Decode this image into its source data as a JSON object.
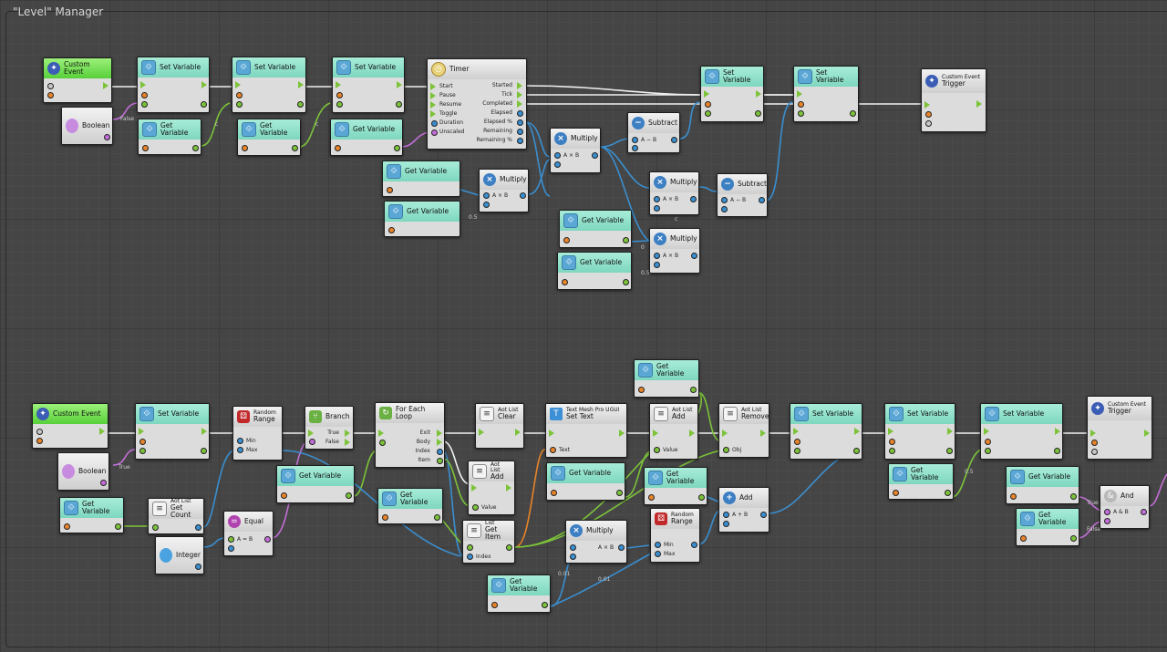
{
  "window": {
    "title": "\"Level\" Manager"
  },
  "top": {
    "custom_event": "Custom Event",
    "boolean": "Boolean",
    "set_variable": "Set Variable",
    "get_variable": "Get Variable",
    "timer": {
      "title": "Timer",
      "inputs": [
        "Start",
        "Pause",
        "Resume",
        "Toggle",
        "Duration",
        "Unscaled"
      ],
      "outputs": [
        "Started",
        "Tick",
        "Completed",
        "Elapsed",
        "Elapsed %",
        "Remaining",
        "Remaining %"
      ]
    },
    "multiply": "Multiply",
    "subtract": "Subtract",
    "event_trigger": {
      "line1": "Custom Event",
      "line2": "Trigger"
    },
    "false_tag": "False",
    "c_tag": "c",
    "half_tag": "0.5",
    "zero_tag": "0",
    "expr_mul": "A × B",
    "expr_sub": "A − B"
  },
  "bottom": {
    "custom_event": "Custom Event",
    "boolean": "Boolean",
    "true_tag": "True",
    "get_variable": "Get Variable",
    "set_variable": "Set Variable",
    "aot_count": {
      "line1": "Aot List",
      "line2": "Get Count"
    },
    "integer": "Integer",
    "random_range": {
      "line1": "Random",
      "line2": "Range",
      "min": "Min",
      "max": "Max"
    },
    "equal": {
      "title": "Equal",
      "expr": "A = B"
    },
    "branch": {
      "title": "Branch",
      "true": "True",
      "false": "False"
    },
    "foreach": {
      "title": "For Each Loop",
      "outs": [
        "Exit",
        "Body",
        "Index",
        "Item"
      ]
    },
    "aot_clear": {
      "line1": "Aot List",
      "line2": "Clear"
    },
    "aot_add": {
      "line1": "Aot List",
      "line2": "Add",
      "value": "Value"
    },
    "list_get": {
      "line1": "List",
      "line2": "Get Item",
      "index": "Index"
    },
    "tmp_settext": {
      "line1": "Text Mesh Pro UGUI",
      "line2": "Set Text",
      "text": "Text"
    },
    "aot_remove": {
      "line1": "Aot List",
      "line2": "Remove",
      "obj": "Obj"
    },
    "add": {
      "title": "Add",
      "expr": "A + B"
    },
    "and": {
      "title": "And",
      "expr": "A & B"
    },
    "multiply": {
      "title": "Multiply",
      "expr": "A × B"
    },
    "event_trigger": {
      "line1": "Custom Event",
      "line2": "Trigger"
    },
    "tags": {
      "t001": "0.01",
      "t05": "0.5",
      "t0": "0",
      "true": "True",
      "false": "False"
    }
  }
}
